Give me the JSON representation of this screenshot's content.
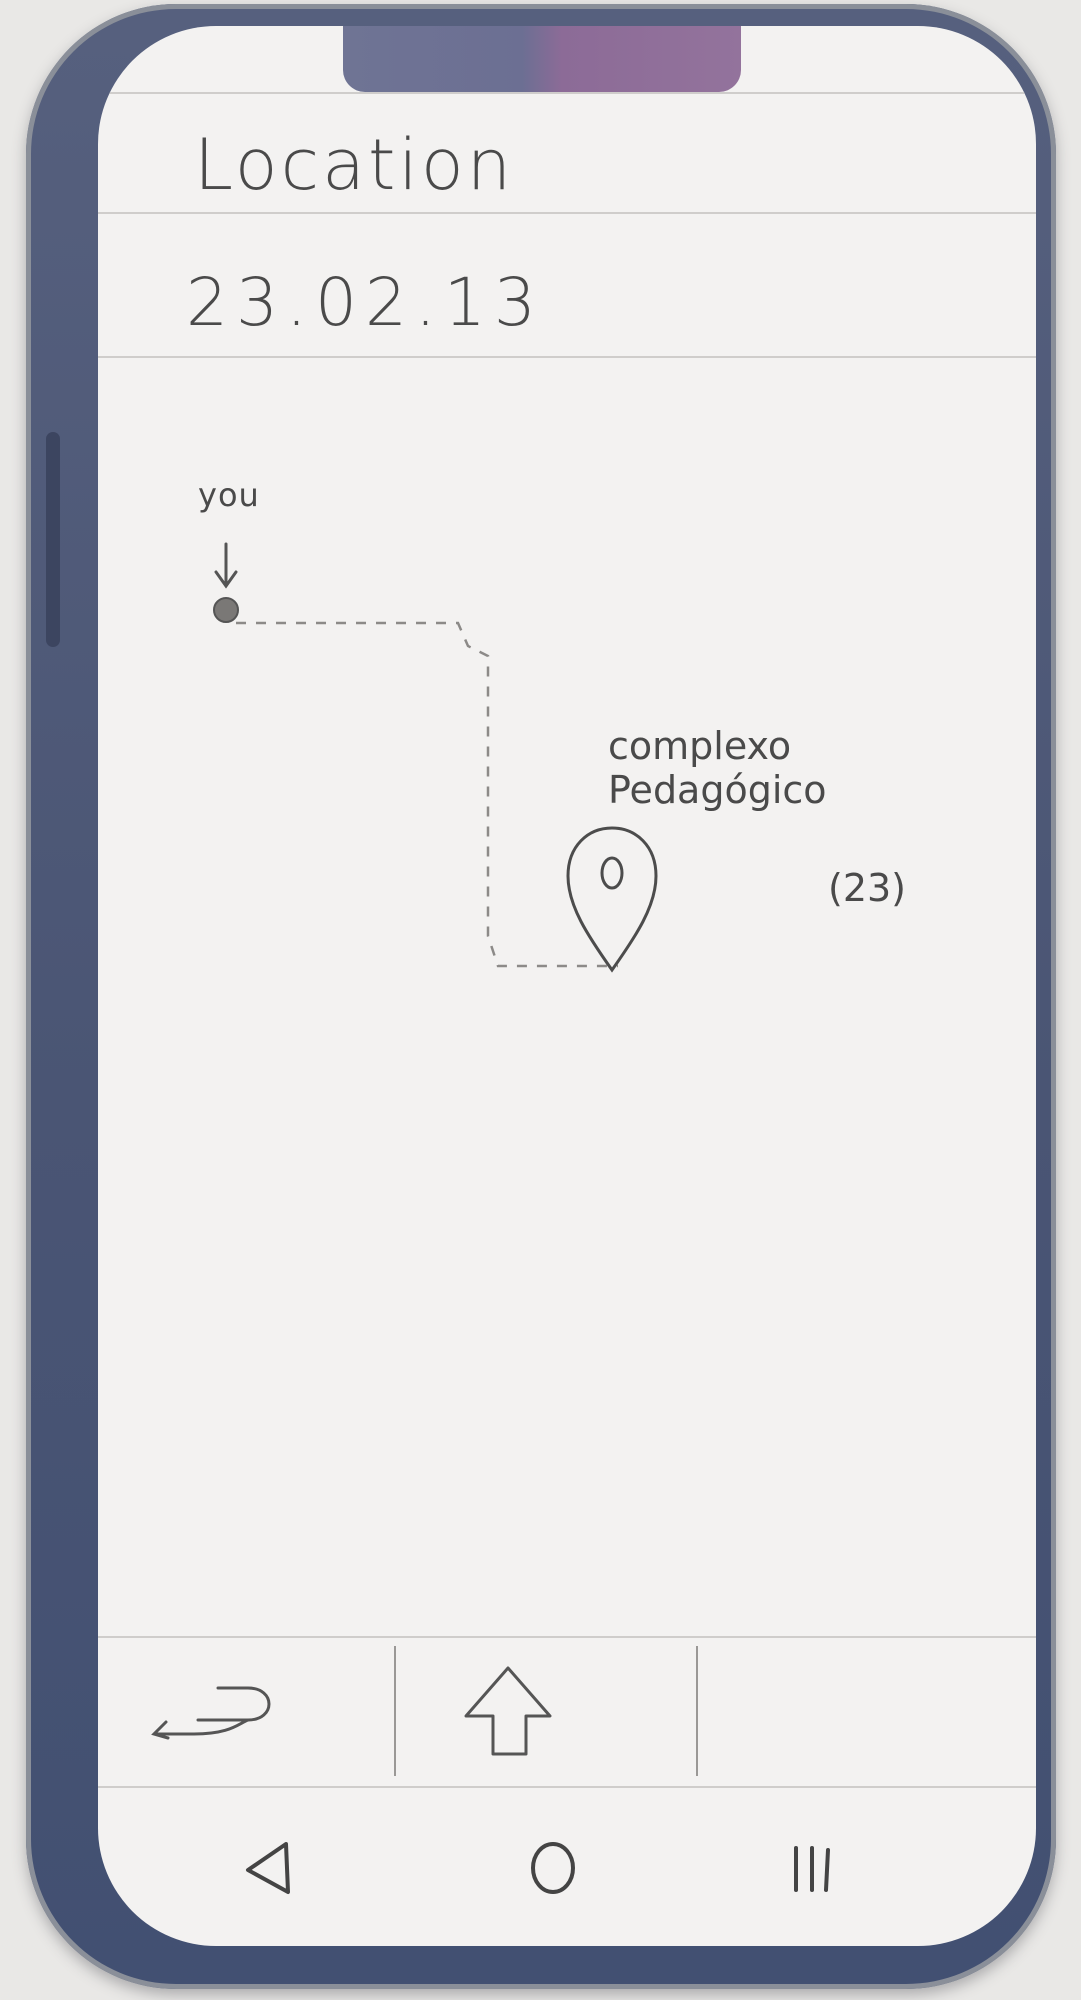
{
  "header": {
    "title": "Location",
    "date": "23.02.13"
  },
  "map": {
    "user_marker_label": "you",
    "destination_name_line1": "complexo",
    "destination_name_line2": "Pedagógico",
    "destination_number": "(23)"
  },
  "toolbar": {
    "back_icon": "return-arrow-icon",
    "up_icon": "up-arrow-icon"
  },
  "nav": {
    "back_icon": "triangle-back-icon",
    "home_icon": "circle-home-icon",
    "recents_icon": "recents-lines-icon"
  },
  "colors": {
    "phone_frame": "#4a5574",
    "screen": "#f3f2f1",
    "pencil": "#4a4a4a",
    "notch_left": "#6f7494",
    "notch_right": "#93739c"
  }
}
